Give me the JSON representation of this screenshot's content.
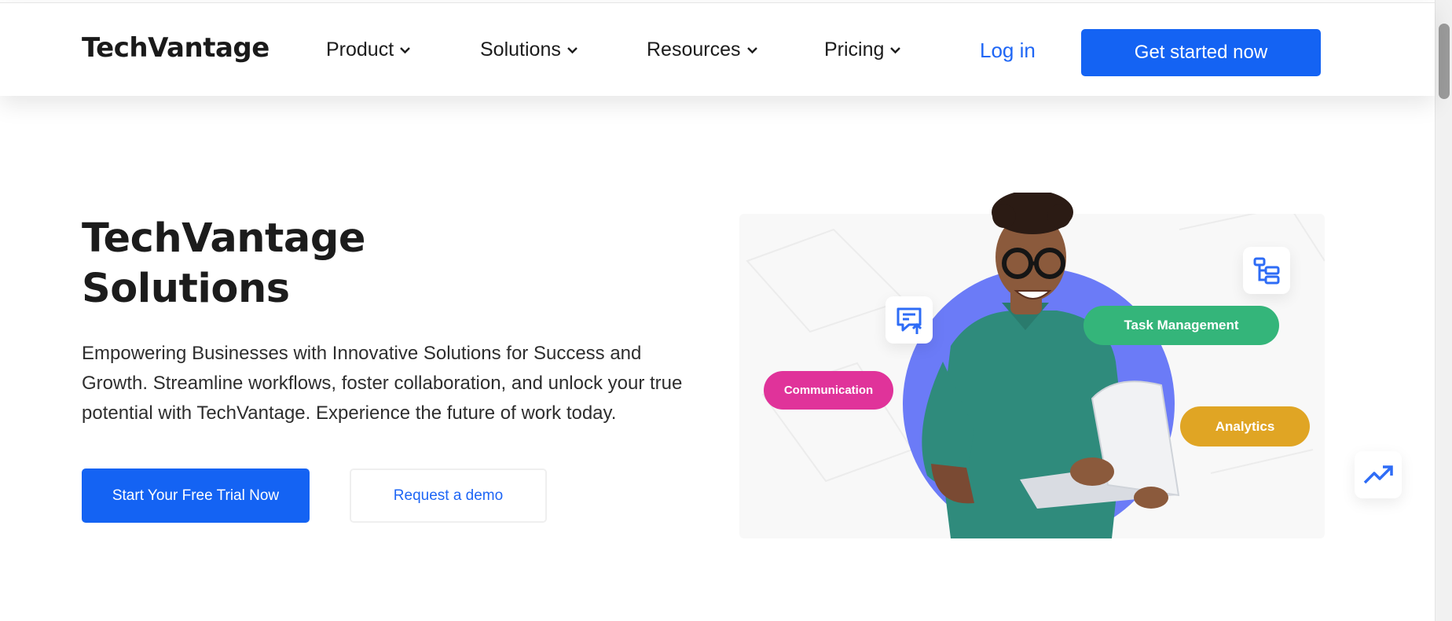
{
  "header": {
    "logo": "TechVantage",
    "nav": [
      {
        "label": "Product"
      },
      {
        "label": "Solutions"
      },
      {
        "label": "Resources"
      },
      {
        "label": "Pricing"
      }
    ],
    "login_label": "Log in",
    "cta_label": "Get started now"
  },
  "hero": {
    "title_line1": "TechVantage",
    "title_line2": "Solutions",
    "description": "Empowering Businesses with Innovative Solutions for Success and Growth. Streamline workflows, foster collaboration, and unlock your true potential with TechVantage. Experience the future of work today.",
    "primary_button": "Start Your Free Trial Now",
    "secondary_button": "Request a demo"
  },
  "illustration": {
    "tags": {
      "communication": "Communication",
      "task_management": "Task Management",
      "analytics": "Analytics"
    },
    "icons": [
      "message-upload-icon",
      "hierarchy-icon",
      "trending-up-icon"
    ]
  },
  "colors": {
    "brand_blue": "#1463f3",
    "link_blue": "#1e66f5",
    "circle_purple": "#6b7bf7",
    "shirt_teal": "#2f8b7c",
    "tag_pink": "#e0339a",
    "tag_green": "#34b57a",
    "tag_gold": "#e0a524"
  }
}
